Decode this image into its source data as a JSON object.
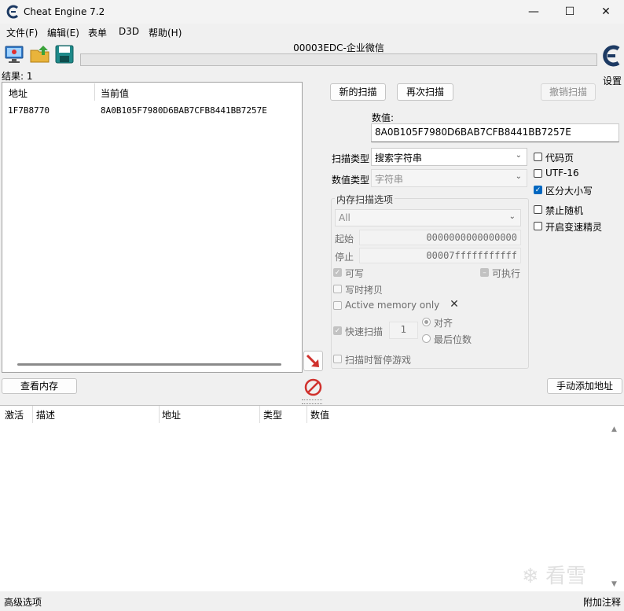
{
  "window": {
    "title": "Cheat Engine 7.2",
    "minimize": "—",
    "maximize": "☐",
    "close": "✕"
  },
  "menu": [
    "文件(F)",
    "编辑(E)",
    "表单",
    "D3D",
    "帮助(H)"
  ],
  "process_title": "00003EDC-企业微信",
  "settings_label": "设置",
  "result_count": "结果: 1",
  "results": {
    "columns": [
      "地址",
      "当前值"
    ],
    "rows": [
      {
        "address": "1F7B8770",
        "value": "8A0B105F7980D6BAB7CFB8441BB7257E"
      }
    ]
  },
  "scan_buttons": {
    "new_scan": "新的扫描",
    "next_scan": "再次扫描",
    "undo_scan": "撤销扫描"
  },
  "value": {
    "label": "数值:",
    "current": "8A0B105F7980D6BAB7CFB8441BB7257E"
  },
  "scan_type": {
    "label": "扫描类型",
    "selected": "搜索字符串"
  },
  "value_type": {
    "label": "数值类型",
    "selected": "字符串"
  },
  "options_right": [
    {
      "label": "代码页",
      "checked": false
    },
    {
      "label": "UTF-16",
      "checked": false
    },
    {
      "label": "区分大小写",
      "checked": true
    },
    {
      "label": "禁止随机",
      "checked": false
    },
    {
      "label": "开启变速精灵",
      "checked": false
    }
  ],
  "memscan": {
    "title": "内存扫描选项",
    "region": "All",
    "start_label": "起始",
    "start_value": "0000000000000000",
    "stop_label": "停止",
    "stop_value": "00007fffffffffff",
    "writable": "可写",
    "executable": "可执行",
    "copy_on_write": "写时拷贝",
    "active_memory": "Active memory only",
    "fast_scan": "快速扫描",
    "fast_scan_value": "1",
    "align": "对齐",
    "last_digits": "最后位数",
    "pause_game": "扫描时暂停游戏"
  },
  "view_memory_button": "查看内存",
  "add_address_button": "手动添加地址",
  "address_list": {
    "columns": [
      "激活",
      "描述",
      "地址",
      "类型",
      "数值"
    ]
  },
  "status": {
    "left": "高级选项",
    "right": "附加注释"
  },
  "watermark": "看雪",
  "colors": {
    "accent": "#0067c0",
    "arrow": "#d0312d",
    "stop": "#d0312d"
  }
}
